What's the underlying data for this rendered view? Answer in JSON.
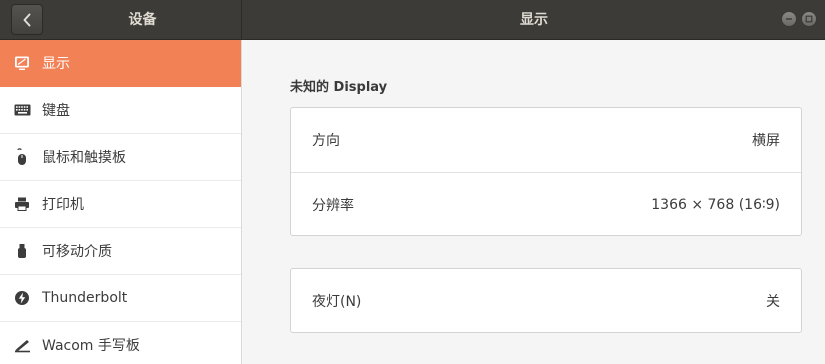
{
  "header": {
    "left_title": "设备",
    "main_title": "显示"
  },
  "sidebar": {
    "items": [
      {
        "label": "显示",
        "icon": "display-icon",
        "active": true
      },
      {
        "label": "键盘",
        "icon": "keyboard-icon",
        "active": false
      },
      {
        "label": "鼠标和触摸板",
        "icon": "mouse-icon",
        "active": false
      },
      {
        "label": "打印机",
        "icon": "printer-icon",
        "active": false
      },
      {
        "label": "可移动介质",
        "icon": "usb-drive-icon",
        "active": false
      },
      {
        "label": "Thunderbolt",
        "icon": "thunderbolt-icon",
        "active": false
      },
      {
        "label": "Wacom 手写板",
        "icon": "tablet-icon",
        "active": false
      }
    ]
  },
  "main": {
    "section_title": "未知的 Display",
    "orientation": {
      "label": "方向",
      "value": "横屏"
    },
    "resolution": {
      "label": "分辨率",
      "value": "1366 × 768 (16∶9)"
    },
    "night_light": {
      "label": "夜灯(N)",
      "value": "关"
    }
  },
  "colors": {
    "accent": "#f28156",
    "header_bg": "#3c3b37"
  }
}
